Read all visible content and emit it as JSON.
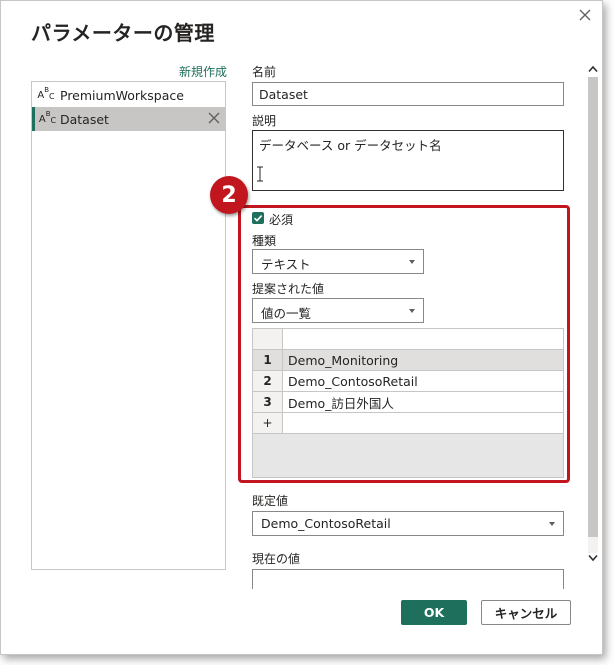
{
  "dialog": {
    "title": "パラメーターの管理",
    "close_icon": "close-icon"
  },
  "sidebar": {
    "new_label": "新規作成",
    "items": [
      {
        "label": "PremiumWorkspace",
        "icon": "abc-text-icon",
        "selected": false
      },
      {
        "label": "Dataset",
        "icon": "abc-text-icon",
        "selected": true
      }
    ]
  },
  "form": {
    "name_label": "名前",
    "name_value": "Dataset",
    "description_label": "説明",
    "description_value": "データベース or データセット名",
    "required_label": "必須",
    "required_checked": true,
    "type_label": "種類",
    "type_value": "テキスト",
    "suggested_label": "提案された値",
    "suggested_value": "値の一覧",
    "values": [
      {
        "num": "1",
        "value": "Demo_Monitoring"
      },
      {
        "num": "2",
        "value": "Demo_ContosoRetail"
      },
      {
        "num": "3",
        "value": "Demo_訪日外国人"
      },
      {
        "num": "+",
        "value": ""
      }
    ],
    "default_label": "既定値",
    "default_value": "Demo_ContosoRetail",
    "current_label": "現在の値"
  },
  "annotation": {
    "step_number": "2",
    "color": "#c2161e"
  },
  "buttons": {
    "ok": "OK",
    "cancel": "キャンセル"
  },
  "colors": {
    "accent": "#1e6f5c",
    "highlight": "#c2161e"
  }
}
